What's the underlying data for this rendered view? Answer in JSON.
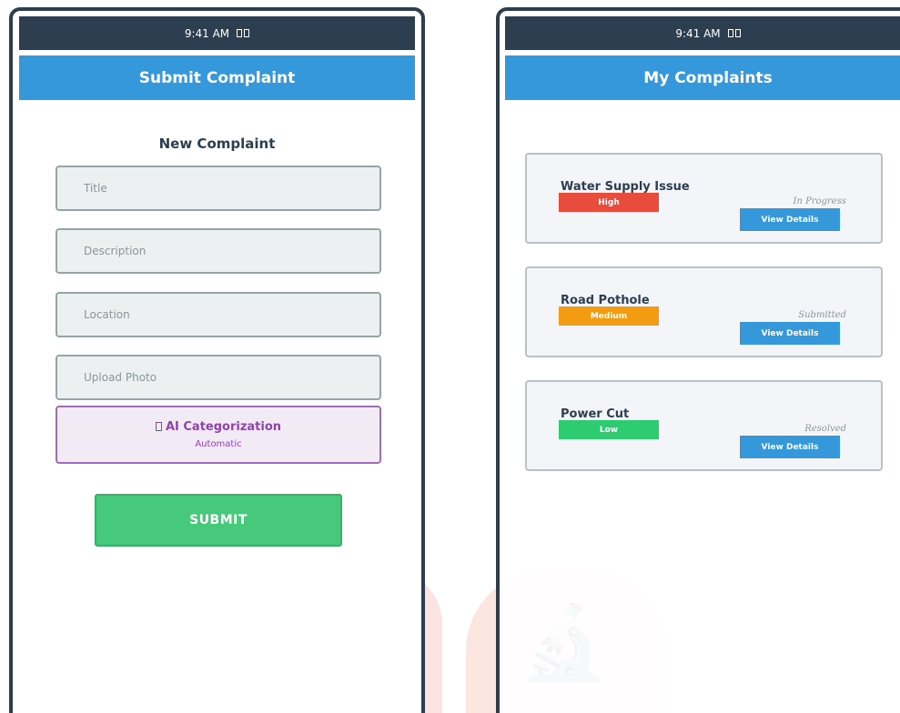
{
  "status_bar": {
    "time": "9:41 AM"
  },
  "submit_screen": {
    "header": "Submit Complaint",
    "form_title": "New Complaint",
    "fields": [
      {
        "placeholder": "Title"
      },
      {
        "placeholder": "Description"
      },
      {
        "placeholder": "Location"
      },
      {
        "placeholder": "Upload Photo"
      }
    ],
    "ai": {
      "title": "AI Categorization",
      "subtitle": "Automatic"
    },
    "submit_label": "SUBMIT"
  },
  "list_screen": {
    "header": "My Complaints",
    "complaints": [
      {
        "title": "Water Supply Issue",
        "priority": "High",
        "priority_color": "#e74c3c",
        "status": "In Progress",
        "button": "View Details"
      },
      {
        "title": "Road Pothole",
        "priority": "Medium",
        "priority_color": "#f39c12",
        "status": "Submitted",
        "button": "View Details"
      },
      {
        "title": "Power Cut",
        "priority": "Low",
        "priority_color": "#2ecc71",
        "status": "Resolved",
        "button": "View Details"
      }
    ]
  },
  "colors": {
    "header": "#3498db",
    "status_bar": "#2c3e50",
    "submit": "#46c97a",
    "ai_accent": "#8e44ad"
  }
}
